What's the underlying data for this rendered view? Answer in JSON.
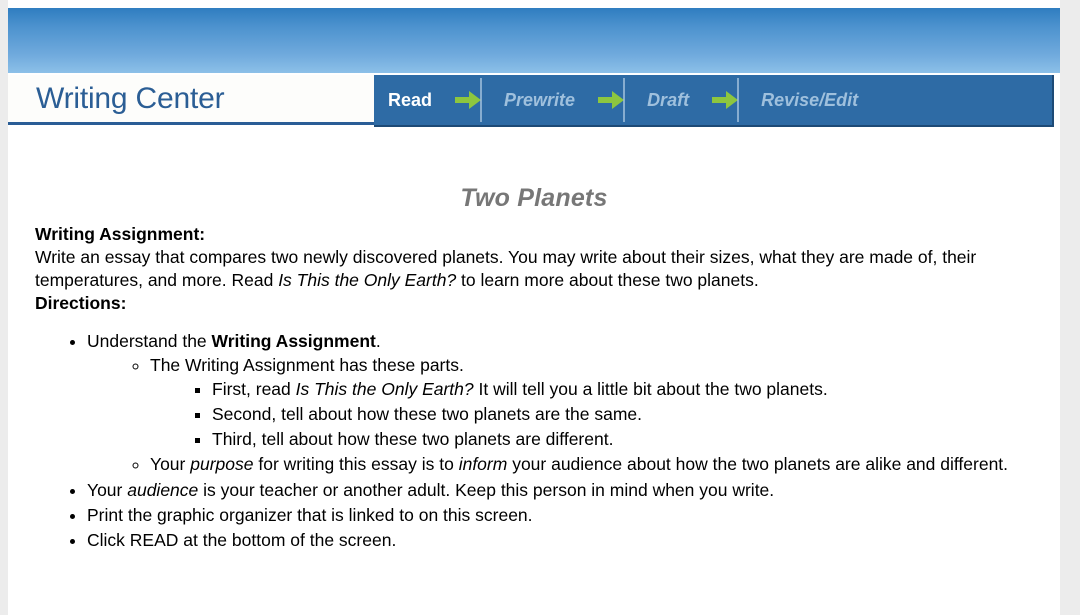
{
  "header": {
    "logo_text": "Writing Center",
    "nav_steps": [
      {
        "label": "Read",
        "state": "active"
      },
      {
        "label": "Prewrite",
        "state": "inactive"
      },
      {
        "label": "Draft",
        "state": "inactive"
      },
      {
        "label": "Revise/Edit",
        "state": "inactive"
      }
    ],
    "arrow_icon": "arrow-right-icon",
    "colors": {
      "banner_top": "#2f7dc0",
      "banner_bottom": "#8cc0e8",
      "navbar_bg": "#2e6ba5",
      "navbar_border": "#1d4a76",
      "logo_color": "#2b5e95",
      "arrow_green": "#8dc63f",
      "inactive_label": "#9fc0dd"
    }
  },
  "document": {
    "title": "Two Planets",
    "assignment_heading": "Writing Assignment:",
    "assignment_text_a": "Write an essay that compares two newly discovered planets. You may write about their sizes, what they are made of, their temperatures, and more. Read ",
    "assignment_book_title": "Is This the Only Earth?",
    "assignment_text_b": " to learn more about these two planets.",
    "directions_heading": "Directions:",
    "directions": {
      "item1_a": "Understand the ",
      "item1_bold": "Writing Assignment",
      "item1_b": ".",
      "sub1": "The Writing Assignment has these parts.",
      "parts": {
        "first_a": "First, read ",
        "first_ital": "Is This the Only Earth?",
        "first_b": " It will tell you a little bit about the two planets.",
        "second": "Second, tell about how these two planets are the same.",
        "third": "Third, tell about how these two planets are different."
      },
      "purpose_a": "Your ",
      "purpose_ital1": "purpose",
      "purpose_b": " for writing this essay is to ",
      "purpose_ital2": "inform",
      "purpose_c": " your audience about how the two planets are alike and different.",
      "audience_a": "Your ",
      "audience_ital": "audience",
      "audience_b": " is your teacher or another adult. Keep this person in mind when you write.",
      "print_item": "Print the graphic organizer that is linked to on this screen.",
      "click_item": "Click READ at the bottom of the screen."
    }
  }
}
